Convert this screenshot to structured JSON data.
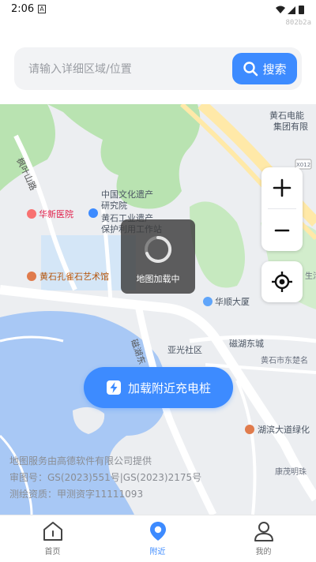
{
  "status_bar": {
    "time": "2:06",
    "notification_letter": "A",
    "build_tag": "802b2a"
  },
  "search": {
    "placeholder": "请输入详细区域/位置",
    "button_label": "搜索"
  },
  "map": {
    "labels": {
      "company": "黄石电能",
      "company2": "集团有限",
      "culture1": "中国文化遗产",
      "culture2": "研究院",
      "industry1": "黄石工业遗产",
      "industry2": "保护利用工作站",
      "hospital": "华新医院",
      "art": "黄石孔雀石艺术馆",
      "building": "华顺大厦",
      "community": "亚光社区",
      "lake_city": "磁湖东城",
      "east_sea": "黄石市东楚名",
      "avenue": "湖滨大道绿化",
      "kang": "康茂明珠",
      "road_fengye": "枫叶山路",
      "road_cihu": "磁湖东",
      "road_shield": "X012",
      "partial_right": "生活"
    },
    "loading_text": "地图加载中"
  },
  "controls": {
    "zoom_in": "+",
    "zoom_out": "−"
  },
  "action_button_label": "加载附近充电桩",
  "attribution": {
    "line1": "地图服务由高德软件有限公司提供",
    "line2": "审图号：GS(2023)551号|GS(2023)2175号",
    "line3": "测绘资质：甲测资字11111093"
  },
  "nav": [
    {
      "label": "首页",
      "icon": "home-icon",
      "active": false
    },
    {
      "label": "附近",
      "icon": "location-pin-icon",
      "active": true
    },
    {
      "label": "我的",
      "icon": "user-icon",
      "active": false
    }
  ],
  "colors": {
    "accent": "#3d8bff",
    "water": "#a8c8f5",
    "park": "#b9e3b1",
    "road_major": "#ffe9a8"
  }
}
